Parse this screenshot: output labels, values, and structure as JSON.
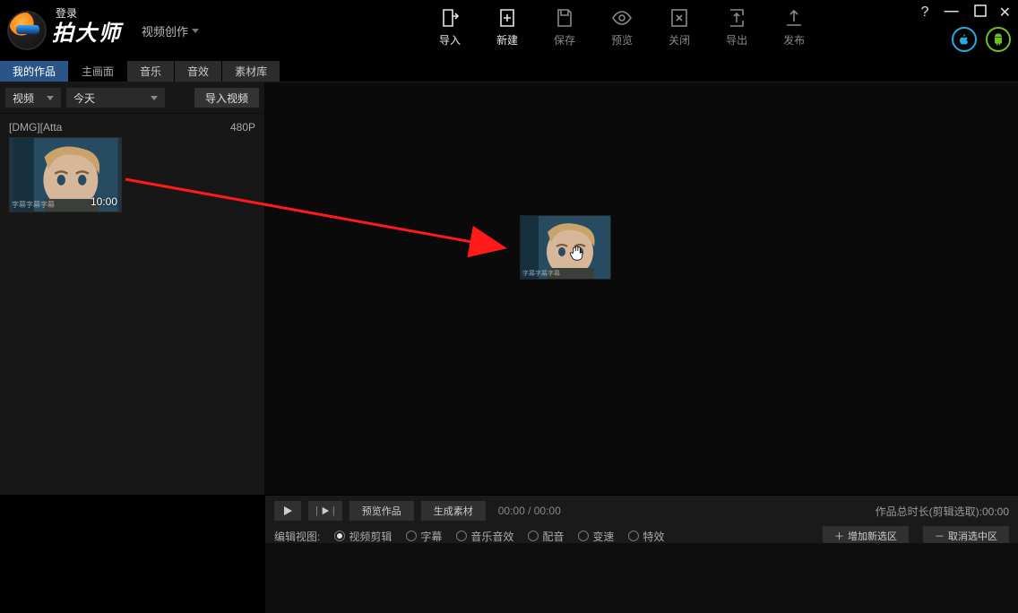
{
  "header": {
    "login_label": "登录",
    "brand": "拍大师",
    "mode_label": "视频创作"
  },
  "toolbar": {
    "import": "导入",
    "new": "新建",
    "save": "保存",
    "preview": "预览",
    "close": "关闭",
    "export": "导出",
    "publish": "发布"
  },
  "tabs": {
    "myworks": "我的作品",
    "main_canvas": "主画面",
    "music": "音乐",
    "sfx": "音效",
    "materials": "素材库"
  },
  "filters": {
    "type_label": "视频",
    "date_label": "今天",
    "import_video_btn": "导入视频"
  },
  "clip": {
    "title": "[DMG][Atta",
    "res": "480P",
    "duration": "10:00",
    "subtitle": "字幕字幕字幕"
  },
  "transport": {
    "preview_work": "预览作品",
    "generate_material": "生成素材",
    "time_readout": "00:00 / 00:00",
    "total_label": "作品总时长(剪辑选取):00:00",
    "edit_view_label": "编辑视图:",
    "views": {
      "video_edit": "视频剪辑",
      "subtitle": "字幕",
      "music_sfx": "音乐音效",
      "voiceover": "配音",
      "speed": "变速",
      "fx": "特效"
    },
    "add_selection": "增加新选区",
    "cancel_selection": "取消选中区"
  }
}
